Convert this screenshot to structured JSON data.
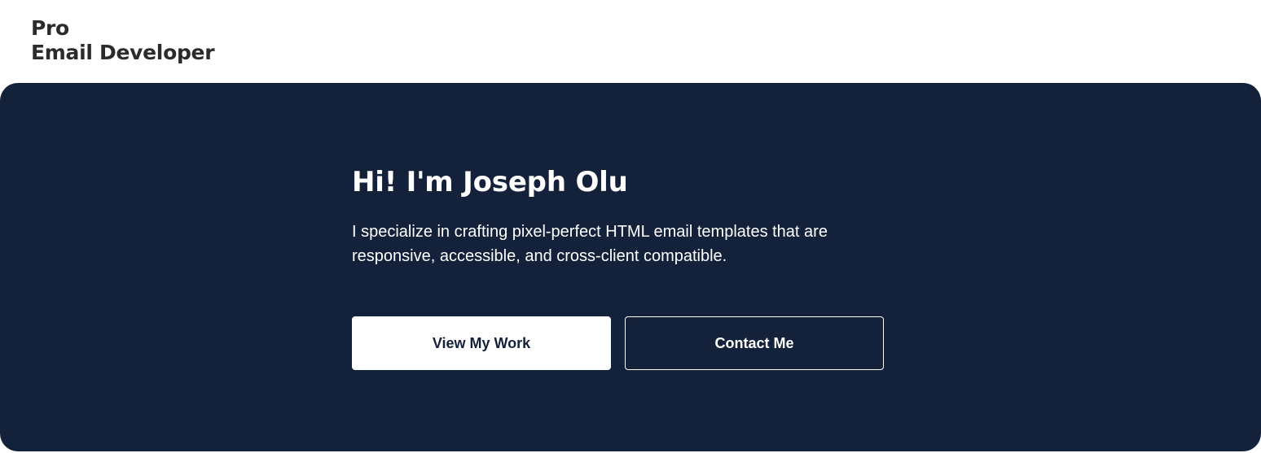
{
  "header": {
    "logo_line1": "Pro",
    "logo_line2": "Email Developer"
  },
  "hero": {
    "title": "Hi! I'm Joseph Olu",
    "description": "I specialize in crafting pixel-perfect HTML email templates that are responsive, accessible, and cross-client compatible.",
    "primary_button": "View My Work",
    "secondary_button": "Contact Me"
  },
  "colors": {
    "hero_background": "#14213a",
    "logo_text": "#2b2b2b",
    "button_primary_bg": "#ffffff"
  }
}
